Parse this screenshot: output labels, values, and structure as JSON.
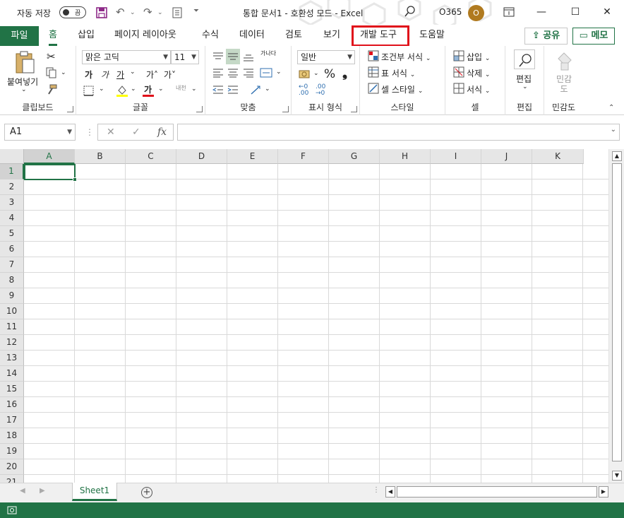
{
  "titlebar": {
    "autosave_label": "자동 저장",
    "autosave_state": "끔",
    "document_title": "통합 문서1  -  호환성 모드  -  Excel",
    "user_name": "O365",
    "avatar_initial": "O"
  },
  "tabs": {
    "file": "파일",
    "items": [
      "홈",
      "삽입",
      "페이지 레이아웃",
      "수식",
      "데이터",
      "검토",
      "보기",
      "개발 도구",
      "도움말"
    ],
    "active": "홈",
    "highlighted": "개발 도구",
    "share": "공유",
    "memo": "메모"
  },
  "ribbon": {
    "clipboard": {
      "name": "클립보드",
      "paste": "붙여넣기"
    },
    "font": {
      "name": "글꼴",
      "font_family": "맑은 고딕",
      "font_size": "11",
      "bold": "가",
      "italic": "가",
      "underline": "가",
      "grow": "가˄",
      "shrink": "가˅",
      "phonetic": "내천"
    },
    "alignment": {
      "name": "맞춤",
      "wrap": "가나다"
    },
    "number": {
      "name": "표시 형식",
      "format": "일반",
      "percent": "%",
      "comma": "❟"
    },
    "styles": {
      "name": "스타일",
      "conditional": "조건부 서식",
      "table": "표 서식",
      "cell": "셀 스타일"
    },
    "cells": {
      "name": "셀",
      "insert": "삽입",
      "delete": "삭제",
      "format": "서식"
    },
    "editing": {
      "name": "편집",
      "label": "편집"
    },
    "sensitivity": {
      "name": "민감도",
      "label": "민감\n도"
    }
  },
  "formula_bar": {
    "name_box": "A1",
    "cancel": "✕",
    "enter": "✓",
    "fx": "fx",
    "value": ""
  },
  "grid": {
    "columns": [
      "A",
      "B",
      "C",
      "D",
      "E",
      "F",
      "G",
      "H",
      "I",
      "J",
      "K"
    ],
    "rows": [
      "1",
      "2",
      "3",
      "4",
      "5",
      "6",
      "7",
      "8",
      "9",
      "10",
      "11",
      "12",
      "13",
      "14",
      "15",
      "16",
      "17",
      "18",
      "19",
      "20",
      "21"
    ],
    "active_cell": "A1"
  },
  "sheets": {
    "tabs": [
      "Sheet1"
    ],
    "active": "Sheet1"
  },
  "colors": {
    "accent": "#217346",
    "highlight": "#e0101a",
    "avatar": "#b07a1f"
  }
}
